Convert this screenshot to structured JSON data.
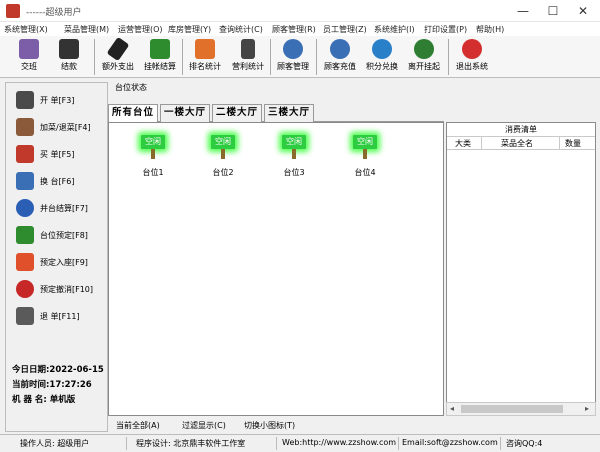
{
  "window": {
    "title": "------超级用户",
    "min": "—",
    "max": "☐",
    "close": "✕"
  },
  "menu": [
    "系统管理(X)",
    "菜品管理(M)",
    "运营管理(O)",
    "库房管理(Y)",
    "查询统计(C)",
    "顾客管理(R)",
    "员工管理(Z)",
    "系统维护(I)",
    "打印设置(P)",
    "帮助(H)"
  ],
  "toolbar": {
    "items": [
      {
        "label": "交班",
        "icon": "shift-handover-icon",
        "color": "#7b5ea7"
      },
      {
        "label": "结款",
        "icon": "settle-money-icon",
        "color": "#333333"
      },
      {
        "label": "额外支出",
        "icon": "extra-expense-icon",
        "color": "#222222"
      },
      {
        "label": "挂帐结算",
        "icon": "credit-settle-icon",
        "color": "#2e8b2e"
      },
      {
        "label": "排名统计",
        "icon": "ranking-stats-icon",
        "color": "#e0702a"
      },
      {
        "label": "营利统计",
        "icon": "profit-stats-icon",
        "color": "#444444"
      },
      {
        "label": "顾客管理",
        "icon": "customer-manage-icon",
        "color": "#3a6fb5"
      },
      {
        "label": "顾客充值",
        "icon": "customer-recharge-icon",
        "color": "#3a6fb5"
      },
      {
        "label": "积分兑换",
        "icon": "points-exchange-icon",
        "color": "#2a7fc9"
      },
      {
        "label": "离开挂起",
        "icon": "hourglass-icon",
        "color": "#2e7d32"
      },
      {
        "label": "退出系统",
        "icon": "exit-icon",
        "color": "#d32f2f"
      }
    ]
  },
  "sidebar": {
    "items": [
      {
        "label": "开      单[F3]",
        "icon": "open-order-icon",
        "color": "#4a4a4a"
      },
      {
        "label": "加菜/退菜[F4]",
        "icon": "add-dish-icon",
        "color": "#8a5a3a"
      },
      {
        "label": "买      单[F5]",
        "icon": "checkout-icon",
        "color": "#c0392b"
      },
      {
        "label": "换      台[F6]",
        "icon": "change-table-icon",
        "color": "#3a6fb5"
      },
      {
        "label": "并台结算[F7]",
        "icon": "merge-table-icon",
        "color": "#2a5fb5"
      },
      {
        "label": "台位预定[F8]",
        "icon": "reserve-table-icon",
        "color": "#2e8b2e"
      },
      {
        "label": "预定入座[F9]",
        "icon": "reserve-seat-icon",
        "color": "#e0502a"
      },
      {
        "label": "预定撤消[F10]",
        "icon": "cancel-reserve-icon",
        "color": "#c62828"
      },
      {
        "label": "退      单[F11]",
        "icon": "return-order-icon",
        "color": "#5a5a5a"
      }
    ],
    "date": "今日日期:2022-06-15",
    "time": "当前时间:17:27:26",
    "machine": "机  器  名: 单机版"
  },
  "main": {
    "section_title": "台位状态",
    "tabs": [
      "所有台位",
      "一楼大厅",
      "二楼大厅",
      "三楼大厅"
    ],
    "seats": [
      {
        "status": "空闲",
        "name": "台位1"
      },
      {
        "status": "空闲",
        "name": "台位2"
      },
      {
        "status": "空闲",
        "name": "台位3"
      },
      {
        "status": "空闲",
        "name": "台位4"
      }
    ],
    "bottom_links": [
      "当前全部(A)",
      "过滤显示(C)",
      "切换小图标(T)"
    ]
  },
  "consume": {
    "title": "消费清单",
    "columns": [
      "大类",
      "菜品全名",
      "数量"
    ],
    "scroll_left": "◂",
    "scroll_right": "▸"
  },
  "status": {
    "operator": "操作人员: 超级用户",
    "designer": "程序设计: 北京鼎丰软件工作室",
    "web": "Web:http://www.zzshow.com",
    "email": "Email:soft@zzshow.com",
    "qq": "咨询QQ:4"
  }
}
